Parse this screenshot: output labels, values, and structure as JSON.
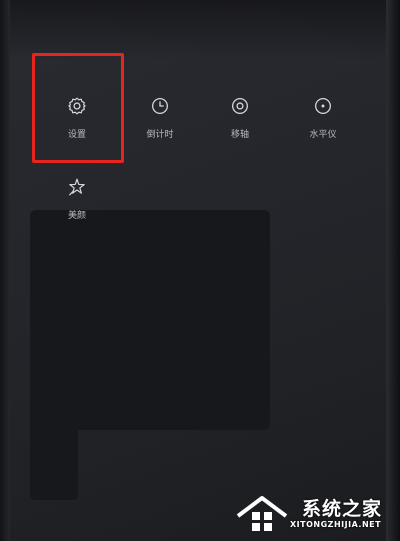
{
  "camera_menu": {
    "items": [
      {
        "label": "设置",
        "icon": "gear-icon"
      },
      {
        "label": "倒计时",
        "icon": "timer-icon"
      },
      {
        "label": "移轴",
        "icon": "tilt-shift-icon"
      },
      {
        "label": "水平仪",
        "icon": "level-icon"
      },
      {
        "label": "美颜",
        "icon": "beauty-sparkle-icon"
      }
    ],
    "highlight_color": "#e8241f"
  },
  "watermark": {
    "brand_cn": "系统之家",
    "brand_en": "XITONGZHIJIA.NET"
  }
}
